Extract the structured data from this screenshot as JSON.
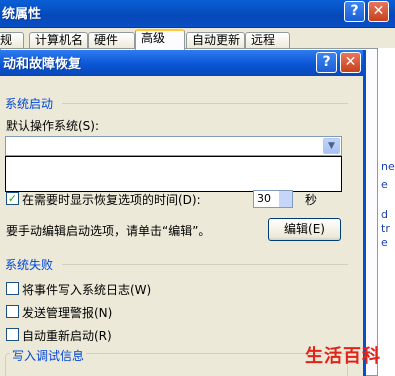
{
  "background_window": {
    "title": "统属性",
    "help_glyph": "?",
    "close_glyph": "✕",
    "tabs": [
      {
        "label": "规"
      },
      {
        "label": "计算机名"
      },
      {
        "label": "硬件"
      },
      {
        "label": "高级",
        "active": true
      },
      {
        "label": "自动更新"
      },
      {
        "label": "远程"
      }
    ],
    "right_edge_fragments": [
      "ne",
      "e",
      "d",
      "tr",
      "e"
    ]
  },
  "dialog": {
    "title": "动和故障恢复",
    "help_glyph": "?",
    "close_glyph": "✕",
    "system_startup": {
      "group_label": "系统启动",
      "default_os_label": "默认操作系统(S):",
      "default_os_value": "",
      "combo_arrow_glyph": "▼",
      "show_recovery_checkbox": {
        "label": "在需要时显示恢复选项的时间(D):",
        "checked": true
      },
      "recovery_time_value": "30",
      "recovery_time_unit": "秒",
      "edit_hint": "要手动编辑启动选项，请单击“编辑”。",
      "edit_button_label": "编辑(E)"
    },
    "system_failure": {
      "group_label": "系统失败",
      "options": [
        {
          "label": "将事件写入系统日志(W)",
          "checked": false
        },
        {
          "label": "发送管理警报(N)",
          "checked": false
        },
        {
          "label": "自动重新启动(R)",
          "checked": false
        }
      ],
      "debug_info_label": "写入调试信息"
    }
  },
  "watermark": "生活百科"
}
